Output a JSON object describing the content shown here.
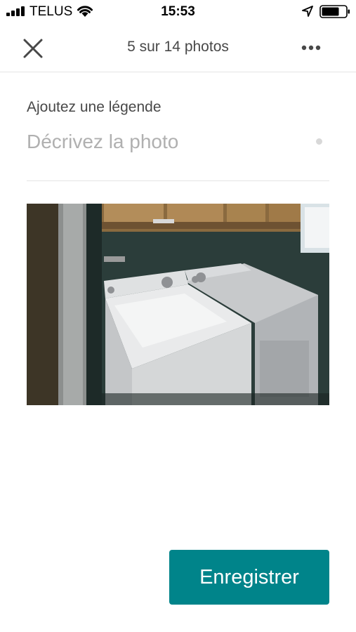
{
  "status_bar": {
    "carrier": "TELUS",
    "time": "15:53"
  },
  "header": {
    "title": "5 sur 14 photos",
    "icons": {
      "close": "close-icon",
      "more": "more-dots-icon"
    }
  },
  "caption": {
    "label": "Ajoutez une légende",
    "placeholder": "Décrivez la photo",
    "value": ""
  },
  "photo": {
    "icon": "photo-laundry-room"
  },
  "footer": {
    "save_label": "Enregistrer"
  },
  "colors": {
    "accent": "#00848a",
    "text": "#484848",
    "placeholder": "#b0b0b0",
    "divider": "#e4e4e4"
  }
}
